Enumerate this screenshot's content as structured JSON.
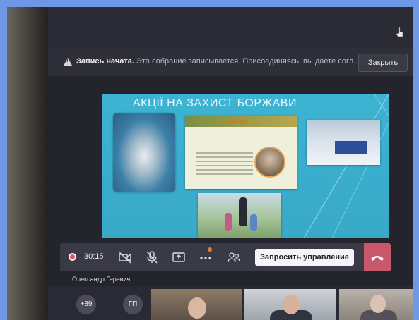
{
  "window": {
    "minimize_glyph": "–",
    "cursor_icon": "hand-cursor-icon"
  },
  "recording_notice": {
    "icon": "warning-icon",
    "bold_text": "Запись начата.",
    "text": "Это собрание записывается. Присоединяясь, вы даете согл...",
    "close_label": "Закрыть"
  },
  "slide": {
    "title": "АКЦІЇ НА  ЗАХИСТ БОРЖАВИ",
    "quote_header": "ЦИТАТА"
  },
  "call_controls": {
    "timer": "30:15",
    "recording_color": "#e25566",
    "icons": [
      "camera-off-icon",
      "mic-off-icon",
      "share-screen-icon",
      "more-icon",
      "participants-icon",
      "hangup-icon"
    ],
    "request_control_label": "Запросить управление",
    "hangup_color": "#c9586b"
  },
  "presenter": {
    "name": "Олександр Геревич"
  },
  "gallery": {
    "overflow_count": "+89",
    "initials": "ГП"
  }
}
